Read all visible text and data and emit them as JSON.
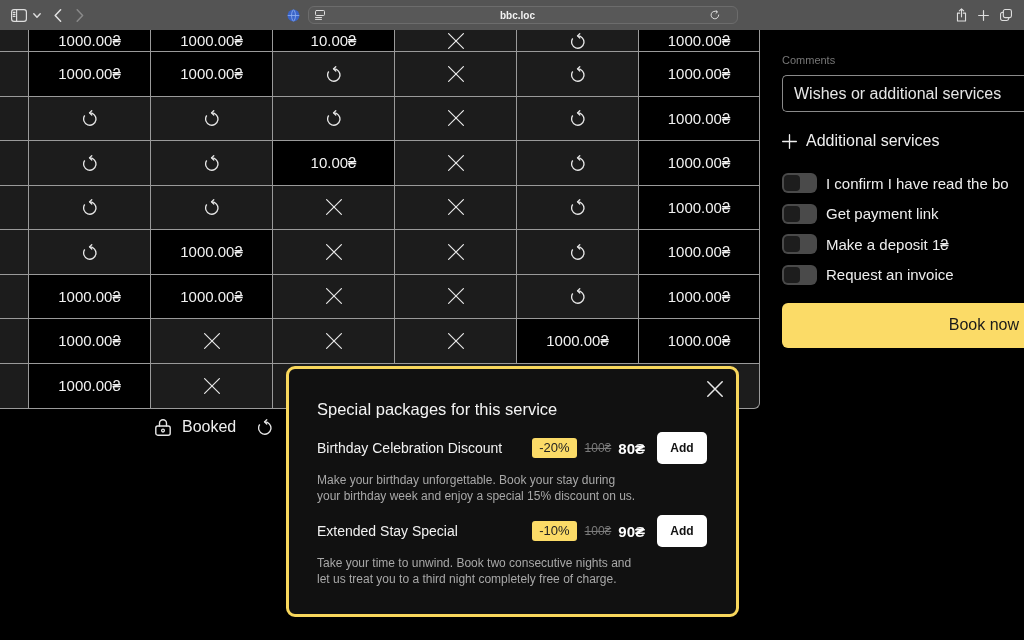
{
  "browser": {
    "nav": [
      {
        "kind": "back",
        "disabled": false
      },
      {
        "kind": "forward",
        "disabled": true
      }
    ],
    "address": "bbc.loc"
  },
  "grid": {
    "rows": [
      {
        "cells": [
          {
            "kind": "price",
            "text": "1000.00₴"
          },
          {
            "kind": "price",
            "text": "1000.00₴"
          },
          {
            "kind": "price",
            "text": "10.00₴"
          },
          {
            "kind": "cross"
          },
          {
            "kind": "refresh"
          },
          {
            "kind": "price",
            "text": "1000.00₴"
          }
        ]
      },
      {
        "cells": [
          {
            "kind": "price",
            "text": "1000.00₴"
          },
          {
            "kind": "price",
            "text": "1000.00₴"
          },
          {
            "kind": "refresh"
          },
          {
            "kind": "cross"
          },
          {
            "kind": "refresh"
          },
          {
            "kind": "price",
            "text": "1000.00₴"
          }
        ]
      },
      {
        "cells": [
          {
            "kind": "refresh"
          },
          {
            "kind": "refresh"
          },
          {
            "kind": "refresh"
          },
          {
            "kind": "cross"
          },
          {
            "kind": "refresh"
          },
          {
            "kind": "price",
            "text": "1000.00₴"
          }
        ]
      },
      {
        "cells": [
          {
            "kind": "refresh"
          },
          {
            "kind": "refresh"
          },
          {
            "kind": "price",
            "text": "10.00₴"
          },
          {
            "kind": "cross"
          },
          {
            "kind": "refresh"
          },
          {
            "kind": "price",
            "text": "1000.00₴"
          }
        ]
      },
      {
        "cells": [
          {
            "kind": "refresh"
          },
          {
            "kind": "refresh"
          },
          {
            "kind": "cross"
          },
          {
            "kind": "cross"
          },
          {
            "kind": "refresh"
          },
          {
            "kind": "price",
            "text": "1000.00₴"
          }
        ]
      },
      {
        "cells": [
          {
            "kind": "refresh"
          },
          {
            "kind": "price",
            "text": "1000.00₴"
          },
          {
            "kind": "cross"
          },
          {
            "kind": "cross"
          },
          {
            "kind": "refresh"
          },
          {
            "kind": "price",
            "text": "1000.00₴"
          }
        ]
      },
      {
        "cells": [
          {
            "kind": "price",
            "text": "1000.00₴"
          },
          {
            "kind": "price",
            "text": "1000.00₴"
          },
          {
            "kind": "cross"
          },
          {
            "kind": "cross"
          },
          {
            "kind": "refresh"
          },
          {
            "kind": "price",
            "text": "1000.00₴"
          }
        ]
      },
      {
        "cells": [
          {
            "kind": "price",
            "text": "1000.00₴"
          },
          {
            "kind": "cross"
          },
          {
            "kind": "cross"
          },
          {
            "kind": "cross"
          },
          {
            "kind": "price",
            "text": "1000.00₴"
          },
          {
            "kind": "price",
            "text": "1000.00₴"
          }
        ]
      },
      {
        "cells": [
          {
            "kind": "price",
            "text": "1000.00₴"
          },
          {
            "kind": "cross"
          }
        ]
      }
    ]
  },
  "legend": [
    {
      "kind": "lock",
      "label": "Booked"
    },
    {
      "kind": "refresh"
    }
  ],
  "booking_form": {
    "comments": {
      "label": "Comments",
      "placeholder": "Wishes or additional services"
    },
    "additional_services": "Additional services",
    "options": [
      {
        "label": "I confirm I have read the bo",
        "on": false
      },
      {
        "label": "Get payment link",
        "on": false
      },
      {
        "label": "Make a deposit 1₴",
        "on": false
      },
      {
        "label": "Request an invoice",
        "on": false
      }
    ],
    "submit": "Book now"
  },
  "packages_dialog": {
    "title": "Special packages for this service",
    "packages": [
      {
        "name": "Birthday Celebration Discount",
        "discount": "-20%",
        "old_price": "100₴",
        "price": "80₴",
        "button": "Add",
        "description": "Make your birthday unforgettable. Book your stay during your birthday week and enjoy a special 15% discount on us."
      },
      {
        "name": "Extended Stay Special",
        "discount": "-10%",
        "old_price": "100₴",
        "price": "90₴",
        "button": "Add",
        "description": "Take your time to unwind. Book two consecutive nights and let us treat you to a third night completely free of charge."
      }
    ]
  }
}
